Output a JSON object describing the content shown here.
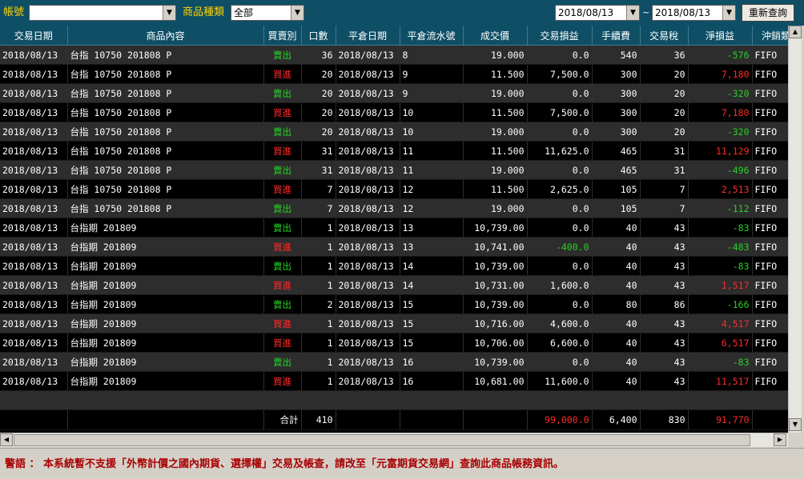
{
  "toolbar": {
    "account_label": "帳號",
    "account_value": "",
    "product_type_label": "商品種類",
    "product_type_value": "全部",
    "date_from": "2018/08/13",
    "date_sep": "~",
    "date_to": "2018/08/13",
    "requery_label": "重新查詢"
  },
  "table": {
    "columns": [
      "交易日期",
      "商品內容",
      "買賣別",
      "口數",
      "平倉日期",
      "平倉流水號",
      "成交價",
      "交易損益",
      "手續費",
      "交易稅",
      "淨損益",
      "沖銷類"
    ],
    "rows": [
      [
        "2018/08/13",
        "台指 10750 201808 P",
        "賣出",
        "36",
        "2018/08/13",
        "8",
        "19.000",
        "0.0",
        "540",
        "36",
        "-576",
        "FIFO"
      ],
      [
        "2018/08/13",
        "台指 10750 201808 P",
        "買進",
        "20",
        "2018/08/13",
        "9",
        "11.500",
        "7,500.0",
        "300",
        "20",
        "7,180",
        "FIFO"
      ],
      [
        "2018/08/13",
        "台指 10750 201808 P",
        "賣出",
        "20",
        "2018/08/13",
        "9",
        "19.000",
        "0.0",
        "300",
        "20",
        "-320",
        "FIFO"
      ],
      [
        "2018/08/13",
        "台指 10750 201808 P",
        "買進",
        "20",
        "2018/08/13",
        "10",
        "11.500",
        "7,500.0",
        "300",
        "20",
        "7,180",
        "FIFO"
      ],
      [
        "2018/08/13",
        "台指 10750 201808 P",
        "賣出",
        "20",
        "2018/08/13",
        "10",
        "19.000",
        "0.0",
        "300",
        "20",
        "-320",
        "FIFO"
      ],
      [
        "2018/08/13",
        "台指 10750 201808 P",
        "買進",
        "31",
        "2018/08/13",
        "11",
        "11.500",
        "11,625.0",
        "465",
        "31",
        "11,129",
        "FIFO"
      ],
      [
        "2018/08/13",
        "台指 10750 201808 P",
        "賣出",
        "31",
        "2018/08/13",
        "11",
        "19.000",
        "0.0",
        "465",
        "31",
        "-496",
        "FIFO"
      ],
      [
        "2018/08/13",
        "台指 10750 201808 P",
        "買進",
        "7",
        "2018/08/13",
        "12",
        "11.500",
        "2,625.0",
        "105",
        "7",
        "2,513",
        "FIFO"
      ],
      [
        "2018/08/13",
        "台指 10750 201808 P",
        "賣出",
        "7",
        "2018/08/13",
        "12",
        "19.000",
        "0.0",
        "105",
        "7",
        "-112",
        "FIFO"
      ],
      [
        "2018/08/13",
        "台指期 201809",
        "賣出",
        "1",
        "2018/08/13",
        "13",
        "10,739.00",
        "0.0",
        "40",
        "43",
        "-83",
        "FIFO"
      ],
      [
        "2018/08/13",
        "台指期 201809",
        "買進",
        "1",
        "2018/08/13",
        "13",
        "10,741.00",
        "-400.0",
        "40",
        "43",
        "-483",
        "FIFO"
      ],
      [
        "2018/08/13",
        "台指期 201809",
        "賣出",
        "1",
        "2018/08/13",
        "14",
        "10,739.00",
        "0.0",
        "40",
        "43",
        "-83",
        "FIFO"
      ],
      [
        "2018/08/13",
        "台指期 201809",
        "買進",
        "1",
        "2018/08/13",
        "14",
        "10,731.00",
        "1,600.0",
        "40",
        "43",
        "1,517",
        "FIFO"
      ],
      [
        "2018/08/13",
        "台指期 201809",
        "賣出",
        "2",
        "2018/08/13",
        "15",
        "10,739.00",
        "0.0",
        "80",
        "86",
        "-166",
        "FIFO"
      ],
      [
        "2018/08/13",
        "台指期 201809",
        "買進",
        "1",
        "2018/08/13",
        "15",
        "10,716.00",
        "4,600.0",
        "40",
        "43",
        "4,517",
        "FIFO"
      ],
      [
        "2018/08/13",
        "台指期 201809",
        "買進",
        "1",
        "2018/08/13",
        "15",
        "10,706.00",
        "6,600.0",
        "40",
        "43",
        "6,517",
        "FIFO"
      ],
      [
        "2018/08/13",
        "台指期 201809",
        "賣出",
        "1",
        "2018/08/13",
        "16",
        "10,739.00",
        "0.0",
        "40",
        "43",
        "-83",
        "FIFO"
      ],
      [
        "2018/08/13",
        "台指期 201809",
        "買進",
        "1",
        "2018/08/13",
        "16",
        "10,681.00",
        "11,600.0",
        "40",
        "43",
        "11,517",
        "FIFO"
      ]
    ],
    "total": {
      "label": "合計",
      "qty": "410",
      "trade_pl": "99,000.0",
      "fee": "6,400",
      "tax": "830",
      "net": "91,770"
    }
  },
  "warning": "警語 ： 本系統暫不支援「外幣計價之國內期貨、選擇權」交易及帳查，請改至「元富期貨交易網」查詢此商品帳務資訊。",
  "colors": {
    "header_bg": "#0e4f66",
    "label_yellow": "#ffd200",
    "sell_green": "#26d126",
    "buy_red": "#ff2a2a",
    "warning_red": "#a80000"
  }
}
